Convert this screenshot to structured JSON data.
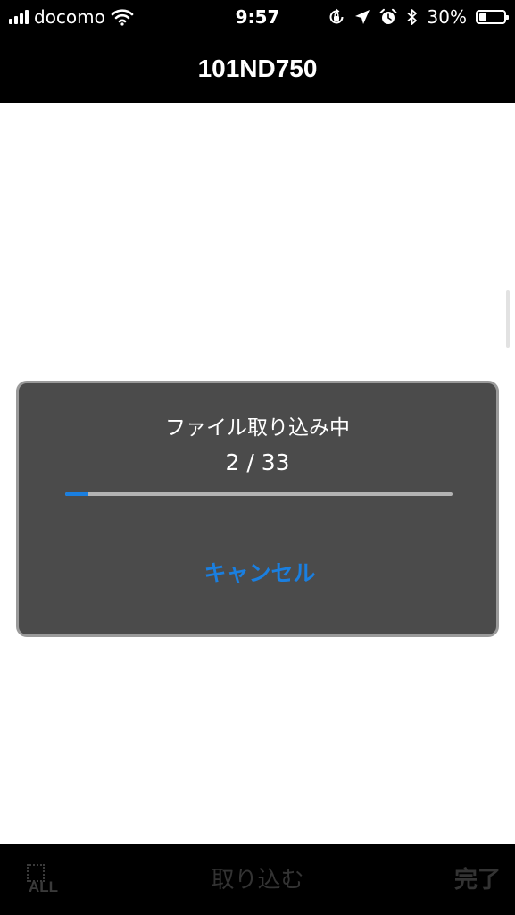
{
  "status_bar": {
    "carrier": "docomo",
    "time": "9:57",
    "battery_percent": "30%",
    "battery_level": 0.3,
    "icons": [
      "signal-icon",
      "wifi-icon",
      "orientation-lock-icon",
      "location-icon",
      "alarm-icon",
      "bluetooth-icon",
      "battery-icon"
    ]
  },
  "nav_bar": {
    "title": "101ND750"
  },
  "dialog": {
    "title": "ファイル取り込み中",
    "progress_text": "2 / 33",
    "progress_fraction": 0.06,
    "cancel_label": "キャンセル"
  },
  "toolbar": {
    "select_all_label": "ALL",
    "import_label": "取り込む",
    "done_label": "完了"
  },
  "colors": {
    "accent": "#1a7fe0",
    "dialog_background": "#4b4b4b",
    "bar_background": "#000000",
    "disabled_text": "#333333"
  }
}
